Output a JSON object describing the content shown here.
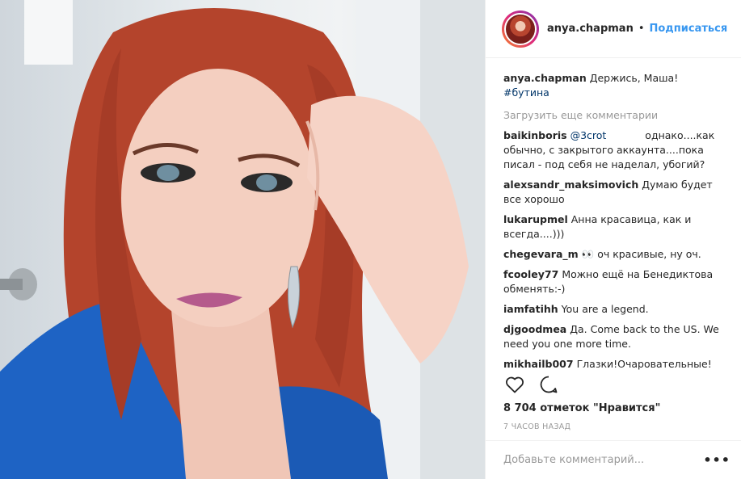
{
  "header": {
    "username": "anya.chapman",
    "dot": "•",
    "follow_label": "Подписаться"
  },
  "caption": {
    "username": "anya.chapman",
    "text": "Держись, Маша!",
    "hashtag": "#бутина"
  },
  "load_more": "Загрузить еще комментарии",
  "comments": [
    {
      "user": "baikinboris",
      "mention": "@3crot",
      "text": "однако....как обычно, с закрытого аккаунта....пока писал - под себя не наделал, убогий?"
    },
    {
      "user": "alexsandr_maksimovich",
      "text": "Думаю будет все хорошо"
    },
    {
      "user": "lukarupmel",
      "text": "Анна красавица, как и всегда....)))"
    },
    {
      "user": "chegevara_m",
      "text": "👀 оч красивые, ну оч."
    },
    {
      "user": "fcooley77",
      "text": "Можно ещё на Бенедиктова обменять:-)"
    },
    {
      "user": "iamfatihh",
      "text": "You are a legend."
    },
    {
      "user": "djgoodmea",
      "text": "Да. Come back to the US. We need you one more time."
    },
    {
      "user": "mikhailb007",
      "text": "Глазки!Очаровательные!"
    }
  ],
  "actions": {
    "like_icon": "heart-icon",
    "comment_icon": "comment-icon"
  },
  "likes": "8 704 отметок \"Нравится\"",
  "timestamp": "7 ЧАСОВ НАЗАД",
  "add_comment": {
    "placeholder": "Добавьте комментарий...",
    "more_icon": "•••"
  },
  "colors": {
    "link_blue": "#3897f0",
    "hashtag": "#003569",
    "muted": "#999999"
  }
}
